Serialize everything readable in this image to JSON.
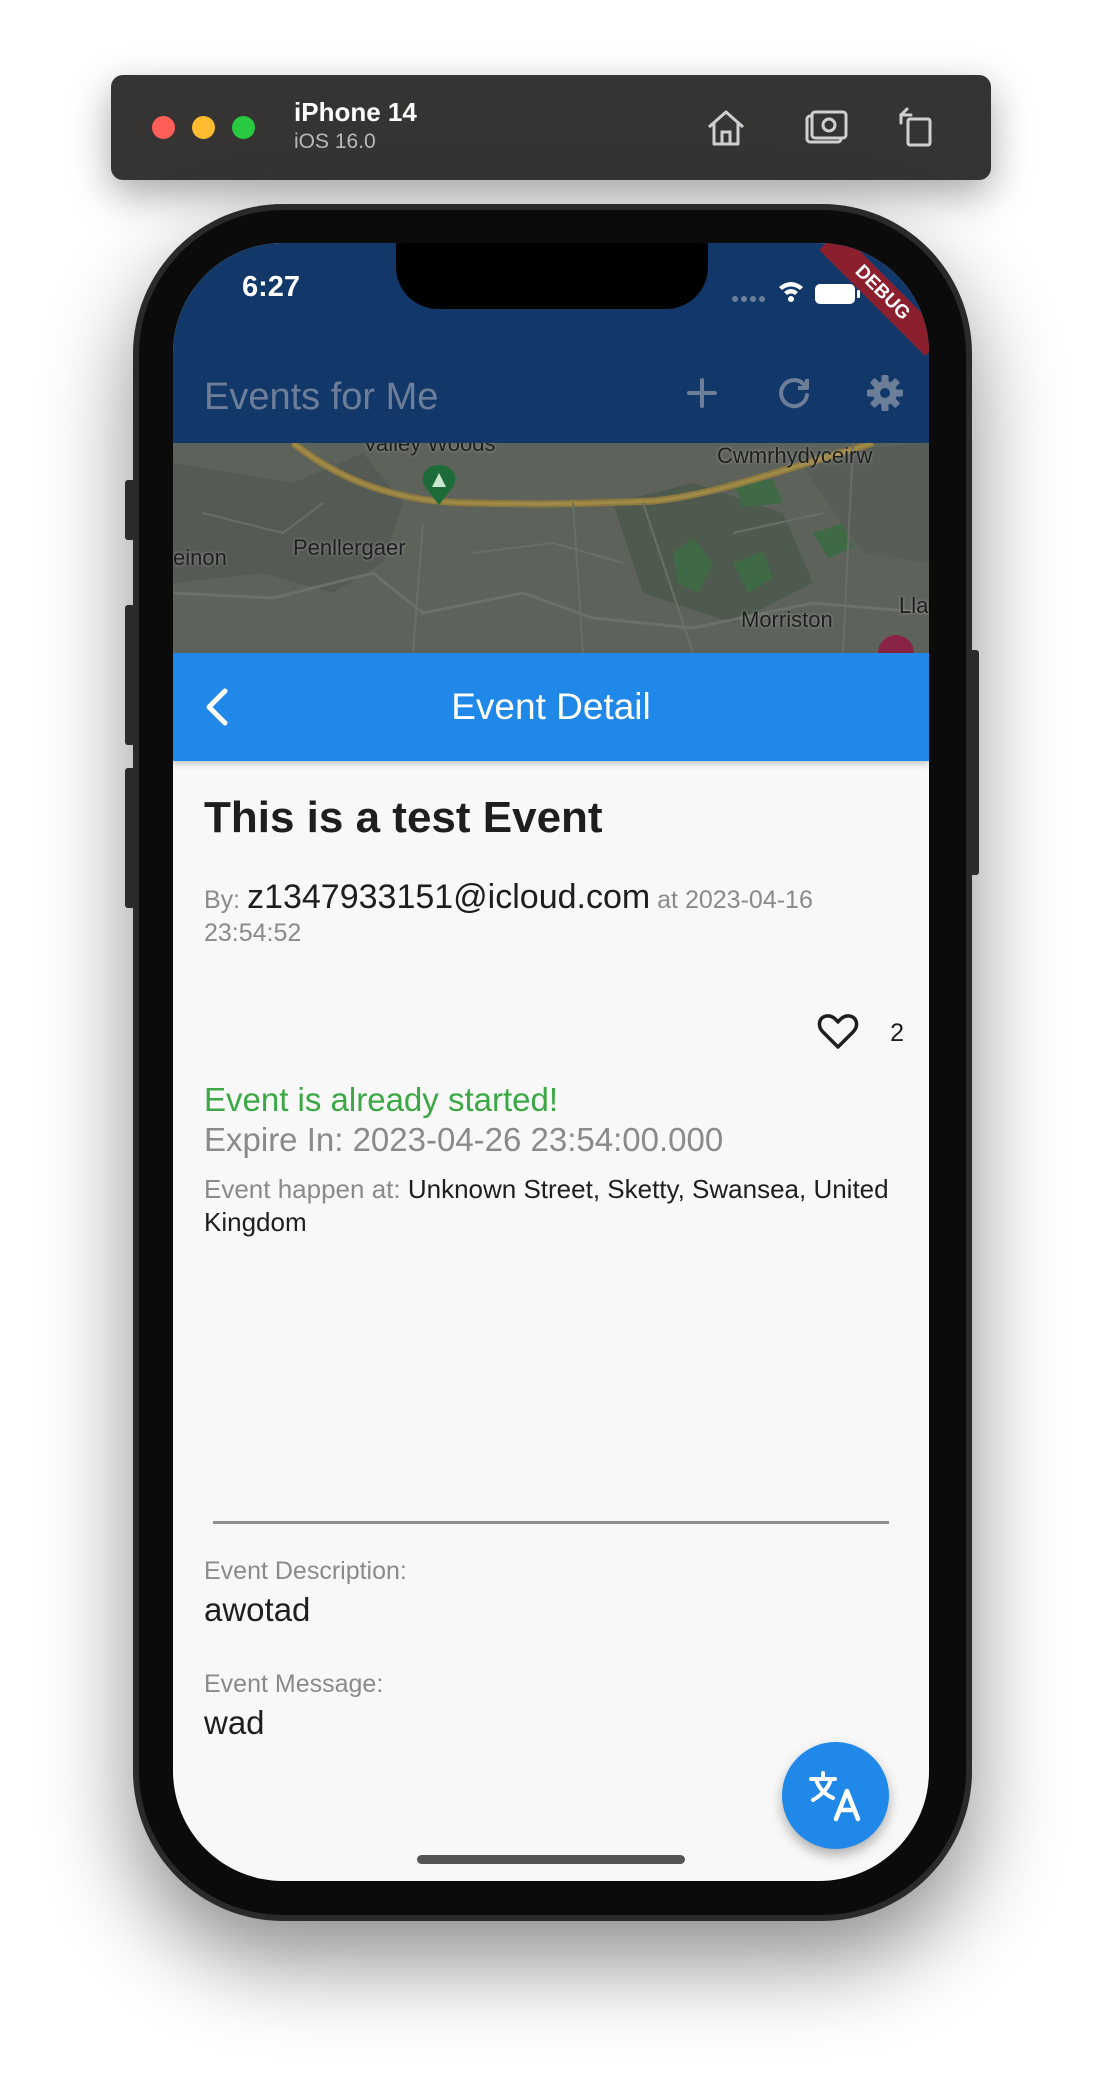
{
  "simulator": {
    "device_name": "iPhone 14",
    "os_version": "iOS 16.0",
    "buttons": [
      "home-icon",
      "screenshot-icon",
      "rotate-icon"
    ]
  },
  "status_bar": {
    "time": "6:27"
  },
  "debug_banner": "DEBUG",
  "app_bar": {
    "title": "Events for Me",
    "actions": [
      "add-icon",
      "refresh-icon",
      "settings-icon"
    ],
    "color": "#12386a"
  },
  "map": {
    "labels": [
      "Valley Woods",
      "Cwmrhydyceirw",
      "einon",
      "Penllergaer",
      "Morriston",
      "Lla"
    ]
  },
  "detail_bar": {
    "title": "Event Detail",
    "color": "#1f88e8"
  },
  "event": {
    "title": "This is a test Event",
    "by_label": "By:",
    "author": "z1347933151@icloud.com",
    "at_label": "at",
    "created": "2023-04-16 23:54:52",
    "likes": "2",
    "status": "Event is already started!",
    "expire_label": "Expire In:",
    "expire_value": "2023-04-26 23:54:00.000",
    "happen_label": "Event happen at:",
    "address": "Unknown Street, Sketty, Swansea, United Kingdom",
    "description_label": "Event Description:",
    "description": "awotad",
    "message_label": "Event Message:",
    "message": "wad"
  },
  "fab": {
    "icon": "translate-icon"
  }
}
